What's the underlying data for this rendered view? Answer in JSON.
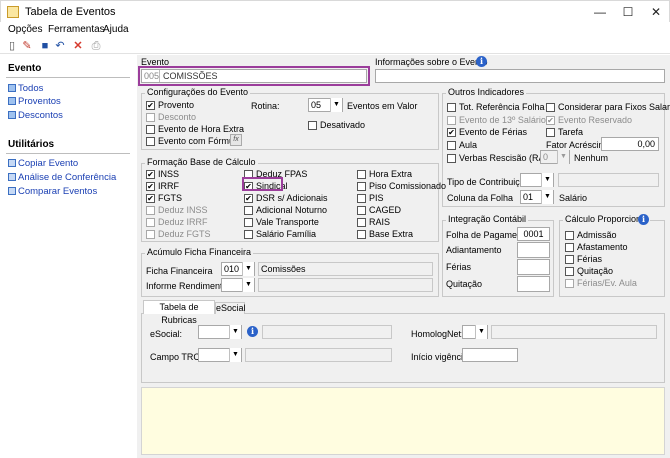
{
  "window": {
    "title": "Tabela de Eventos",
    "minimize": "—",
    "maximize": "☐",
    "close": "✕"
  },
  "menu": [
    "Opções",
    "Ferramentas",
    "Ajuda"
  ],
  "sidebar": {
    "evento_header": "Evento",
    "evento_items": [
      "Todos",
      "Proventos",
      "Descontos"
    ],
    "util_header": "Utilitários",
    "util_items": [
      "Copiar Evento",
      "Análise de Conferência",
      "Comparar Eventos"
    ]
  },
  "evento": {
    "label": "Evento",
    "code": "005",
    "name": "COMISSÕES",
    "info_label": "Informações sobre o Evento",
    "info_value": ""
  },
  "config": {
    "legend": "Configurações do Evento",
    "provento": "Provento",
    "provento_checked": true,
    "desconto": "Desconto",
    "hora_extra": "Evento de Hora Extra",
    "formula": "Evento com Fórmula",
    "fx": "fx",
    "rotina_label": "Rotina:",
    "rotina_code": "05",
    "rotina_value": "Eventos em Valor",
    "desativado": "Desativado"
  },
  "outros": {
    "legend": "Outros Indicadores",
    "tot_ref": "Tot. Referência Folha",
    "fixos": "Considerar para Fixos Salariais",
    "decimo": "Evento de 13º Salário",
    "reservado": "Evento Reservado",
    "reservado_checked": true,
    "ferias": "Evento de Férias",
    "ferias_checked": true,
    "tarefa": "Tarefa",
    "aula": "Aula",
    "fator_label": "Fator Acréscimo",
    "fator_value": "0,00",
    "verbas": "Verbas Rescisão (RAIS)",
    "verbas_code": "0",
    "verbas_value": "Nenhum",
    "tipo_contrib": "Tipo de Contribuição",
    "coluna_label": "Coluna da Folha",
    "coluna_code": "01",
    "coluna_value": "Salário"
  },
  "base": {
    "legend": "Formação Base de Cálculo",
    "col1": [
      {
        "label": "INSS",
        "checked": true,
        "disabled": false
      },
      {
        "label": "IRRF",
        "checked": true,
        "disabled": false
      },
      {
        "label": "FGTS",
        "checked": true,
        "disabled": false
      },
      {
        "label": "Deduz INSS",
        "checked": false,
        "disabled": true
      },
      {
        "label": "Deduz IRRF",
        "checked": false,
        "disabled": true
      },
      {
        "label": "Deduz FGTS",
        "checked": false,
        "disabled": true
      }
    ],
    "col2": [
      {
        "label": "Deduz FPAS",
        "checked": false
      },
      {
        "label": "Sindical",
        "checked": true
      },
      {
        "label": "DSR s/ Adicionais",
        "checked": true
      },
      {
        "label": "Adicional Noturno",
        "checked": false
      },
      {
        "label": "Vale Transporte",
        "checked": false
      },
      {
        "label": "Salário Família",
        "checked": false
      }
    ],
    "col3": [
      {
        "label": "Hora Extra",
        "checked": false
      },
      {
        "label": "Piso Comissionado",
        "checked": false
      },
      {
        "label": "PIS",
        "checked": false
      },
      {
        "label": "CAGED",
        "checked": false
      },
      {
        "label": "RAIS",
        "checked": false
      },
      {
        "label": "Base Extra",
        "checked": false
      }
    ]
  },
  "integracao": {
    "legend": "Integração Contábil",
    "folha": "Folha de Pagamento",
    "folha_value": "0001",
    "adiantamento": "Adiantamento",
    "ferias": "Férias",
    "quitacao": "Quitação"
  },
  "calculo": {
    "legend": "Cálculo Proporcional",
    "items": [
      "Admissão",
      "Afastamento",
      "Férias",
      "Quitação",
      "Férias/Ev. Aula"
    ]
  },
  "acumulo": {
    "legend": "Acúmulo Ficha Financeira",
    "ficha_label": "Ficha Financeira",
    "ficha_code": "010",
    "ficha_value": "Comissões",
    "informe_label": "Informe Rendimentos"
  },
  "tabs": [
    "Tabela de Rubricas",
    "eSocial"
  ],
  "rubricas": {
    "esocial": "eSocial:",
    "homolognet": "HomologNet:",
    "campo_trct": "Campo TRCT:",
    "inicio": "Início vigência:"
  }
}
